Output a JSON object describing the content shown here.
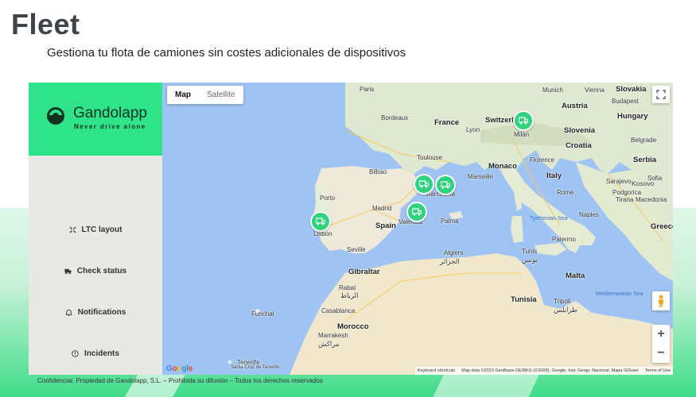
{
  "page": {
    "title": "Fleet",
    "subtitle": "Gestiona tu flota de camiones sin costes adicionales de dispositivos",
    "footer": "Confidencial. Propiedad de Gandolapp, S.L. – Prohibida su difusión  – Todos los derechos reservados"
  },
  "brand": {
    "name": "Gandolapp",
    "tagline": "Never drive alone",
    "color": "#2fe38a"
  },
  "sidebar": {
    "items": [
      {
        "label": "LTC layout",
        "icon": "layout-icon"
      },
      {
        "label": "Check status",
        "icon": "truck-icon"
      },
      {
        "label": "Notifications",
        "icon": "bell-icon"
      },
      {
        "label": "Incidents",
        "icon": "alert-circle-icon"
      }
    ]
  },
  "map": {
    "type_buttons": {
      "map": "Map",
      "satellite": "Satellite"
    },
    "selected_type": "Map",
    "zoom_in": "+",
    "zoom_out": "−",
    "google_logo": "Google",
    "attribution": {
      "shortcuts": "Keyboard shortcuts",
      "data": "Map data ©2023 GeoBasis-DE/BKG (©2009), Google, Inst. Geogr. Nacional, Mapa GISrael",
      "terms": "Terms of Use"
    },
    "markers": [
      "Milan",
      "Barcelona",
      "Barcelona",
      "Valencia",
      "Lisbon"
    ],
    "labels": {
      "countries": [
        "France",
        "Spain",
        "Italy",
        "Switzerland",
        "Austria",
        "Slovenia",
        "Croatia",
        "Serbia",
        "Hungary",
        "Slovakia",
        "Tunisia",
        "Morocco",
        "Malta",
        "Greece",
        "Kosovo"
      ],
      "cities": [
        "Munich",
        "Vienna",
        "Budapest",
        "Paris",
        "Lyon",
        "Milan",
        "Florence",
        "Rome",
        "Naples",
        "Monaco",
        "Marseille",
        "Porto",
        "Madrid",
        "Lisbon",
        "Valencia",
        "Seville",
        "Palma",
        "Barcelona",
        "Algiers",
        "Tunis",
        "Gibraltar",
        "Rabat",
        "Casablanca",
        "Marrakesh",
        "Palermo",
        "Tripoli",
        "Sarajevo",
        "Belgrade",
        "Sofia",
        "Podgorica",
        "Tirana",
        "Macedonia",
        "Bordeaux",
        "Toulouse",
        "Bilbao",
        "Tenerife",
        "Funchal",
        "Santa Cruz de Tenerife"
      ],
      "seas": [
        "Tyrrhenian Sea",
        "Mediterranean Sea"
      ],
      "arabic": [
        "الجزائر",
        "تونس",
        "الرباط",
        "مراكش",
        "طرابلس"
      ]
    }
  }
}
